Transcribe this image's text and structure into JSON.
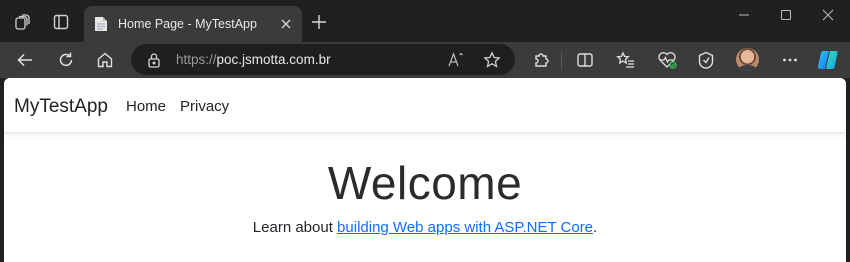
{
  "browser": {
    "tab": {
      "title": "Home Page - MyTestApp"
    },
    "address": {
      "scheme": "https://",
      "host": "poc.jsmotta.com.br"
    },
    "icons": {
      "workspaces": "workspaces-icon",
      "vertical_tabs": "vertical-tabs-icon",
      "favicon": "page-favicon-icon",
      "close_tab": "close-icon",
      "new_tab": "plus-icon",
      "back": "back-arrow-icon",
      "refresh": "refresh-icon",
      "home": "home-icon",
      "lock": "lock-icon",
      "read_aloud": "read-aloud-icon",
      "favorite": "star-icon",
      "extensions": "puzzle-icon",
      "split_screen": "split-screen-icon",
      "favorites": "favorites-list-icon",
      "health": "browser-essentials-icon",
      "collections": "collections-icon",
      "profile": "profile-avatar",
      "more": "more-icon",
      "copilot": "copilot-icon"
    }
  },
  "site": {
    "brand": "MyTestApp",
    "nav": {
      "home": "Home",
      "privacy": "Privacy"
    },
    "main": {
      "heading": "Welcome",
      "text_before": "Learn about ",
      "link_text": "building Web apps with ASP.NET Core",
      "text_after": "."
    }
  },
  "colors": {
    "link": "#0d6efd",
    "browser_bg": "#202020",
    "toolbar_bg": "#3b3b3b"
  }
}
